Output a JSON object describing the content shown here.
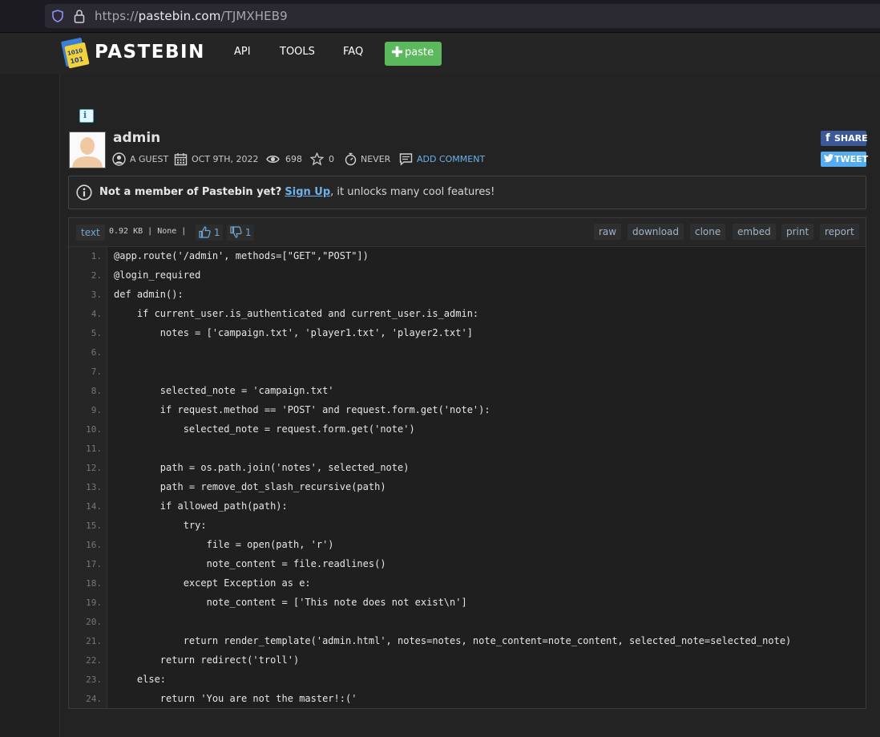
{
  "browser": {
    "url_protocol": "https://",
    "url_host": "pastebin.com",
    "url_path": "/TJMXHEB9"
  },
  "header": {
    "logo": "PASTEBIN",
    "nav": [
      "API",
      "TOOLS",
      "FAQ"
    ],
    "paste_button": "paste"
  },
  "paste": {
    "title": "admin",
    "author": "A GUEST",
    "date": "OCT 9TH, 2022",
    "views": "698",
    "stars": "0",
    "expires": "NEVER",
    "add_comment": "ADD COMMENT",
    "share_label": "SHARE",
    "tweet_label": "TWEET"
  },
  "notice": {
    "lead": "Not a member of Pastebin yet?",
    "link": "Sign Up",
    "rest": ", it unlocks many cool features!"
  },
  "code_header": {
    "syntax": "text",
    "meta": "0.92 KB | None |",
    "likes": "1",
    "dislikes": "1",
    "actions": [
      "raw",
      "download",
      "clone",
      "embed",
      "print",
      "report"
    ]
  },
  "code_lines": [
    "@app.route('/admin', methods=[\"GET\",\"POST\"])",
    "@login_required",
    "def admin():",
    "    if current_user.is_authenticated and current_user.is_admin:",
    "        notes = ['campaign.txt', 'player1.txt', 'player2.txt']",
    "",
    "",
    "        selected_note = 'campaign.txt'",
    "        if request.method == 'POST' and request.form.get('note'):",
    "            selected_note = request.form.get('note')",
    "",
    "        path = os.path.join('notes', selected_note)",
    "        path = remove_dot_slash_recursive(path)",
    "        if allowed_path(path):",
    "            try:",
    "                file = open(path, 'r')",
    "                note_content = file.readlines()",
    "            except Exception as e:",
    "                note_content = ['This note does not exist\\n']",
    "",
    "            return render_template('admin.html', notes=notes, note_content=note_content, selected_note=selected_note)",
    "        return redirect('troll')",
    "    else:",
    "        return 'You are not the master!:('"
  ]
}
